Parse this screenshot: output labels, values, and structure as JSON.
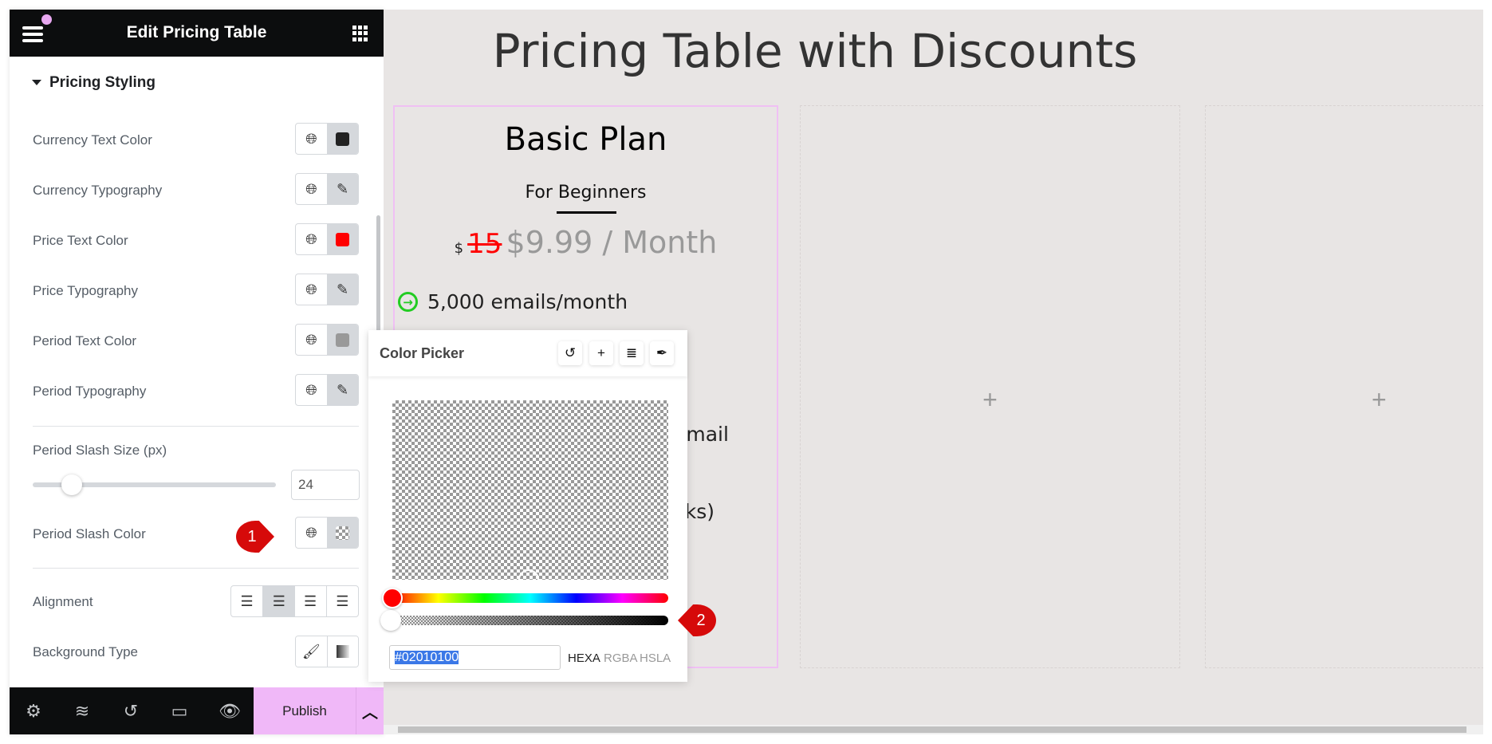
{
  "panel": {
    "title": "Edit Pricing Table",
    "section": "Pricing Styling",
    "rows": [
      {
        "label": "Currency Text Color",
        "swatch": "#222222"
      },
      {
        "label": "Currency Typography",
        "icon": "pencil-icon"
      },
      {
        "label": "Price Text Color",
        "swatch": "#ff0000"
      },
      {
        "label": "Price Typography",
        "icon": "pencil-icon"
      },
      {
        "label": "Period Text Color",
        "swatch": "#999999"
      },
      {
        "label": "Period Typography",
        "icon": "pencil-icon"
      }
    ],
    "slash_size": {
      "label": "Period Slash Size (px)",
      "value": "24",
      "fraction": 0.1
    },
    "slash_color": {
      "label": "Period Slash Color"
    },
    "alignment": {
      "label": "Alignment",
      "selected": "center"
    },
    "background_type": {
      "label": "Background Type"
    },
    "footer": {
      "publish": "Publish"
    }
  },
  "canvas": {
    "title": "Pricing Table with Discounts",
    "card": {
      "name": "Basic Plan",
      "subtitle": "For Beginners",
      "currency": "$",
      "old_price": "15",
      "price": "$9.99 / Month",
      "features": [
        "5,000 emails/month"
      ],
      "partial_features": [
        "email",
        "cks)"
      ]
    },
    "add_icon": "+"
  },
  "picker": {
    "title": "Color Picker",
    "value": "#02010100",
    "formats": [
      "HEXA",
      "RGBA",
      "HSLA"
    ],
    "alpha": 0
  },
  "markers": [
    "1",
    "2"
  ],
  "colors": {
    "accent": "#f0b8f8",
    "marker": "#d60a0a",
    "price_old": "#ff0000",
    "feature_icon": "#22cc22"
  }
}
